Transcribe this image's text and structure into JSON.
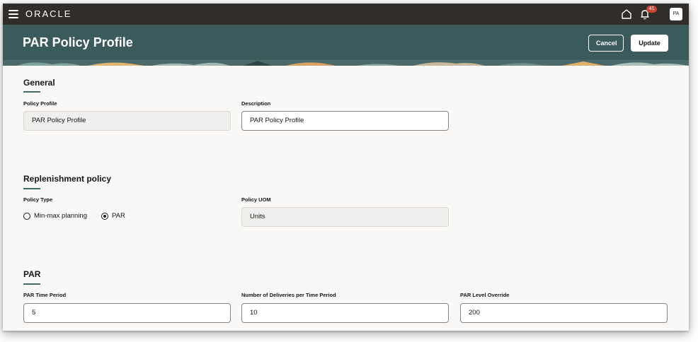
{
  "header": {
    "logo": "ORACLE",
    "notification_count": "41",
    "avatar_initials": "PA"
  },
  "page": {
    "title": "PAR Policy Profile",
    "cancel_label": "Cancel",
    "update_label": "Update"
  },
  "general": {
    "title": "General",
    "policy_profile_label": "Policy Profile",
    "policy_profile_value": "PAR Policy Profile",
    "description_label": "Description",
    "description_value": "PAR Policy Profile"
  },
  "replenishment": {
    "title": "Replenishment policy",
    "policy_type_label": "Policy Type",
    "options": [
      "Min-max planning",
      "PAR"
    ],
    "selected_option": "PAR",
    "policy_uom_label": "Policy UOM",
    "policy_uom_value": "Units"
  },
  "par": {
    "title": "PAR",
    "time_period_label": "PAR Time Period",
    "time_period_value": "5",
    "deliveries_label": "Number of Deliveries per Time Period",
    "deliveries_value": "10",
    "level_override_label": "PAR Level Override",
    "level_override_value": "200"
  },
  "colors": {
    "topbar": "#312d2a",
    "banner": "#3b5a5c",
    "accent": "#3f6b6b",
    "badge": "#c74634"
  }
}
